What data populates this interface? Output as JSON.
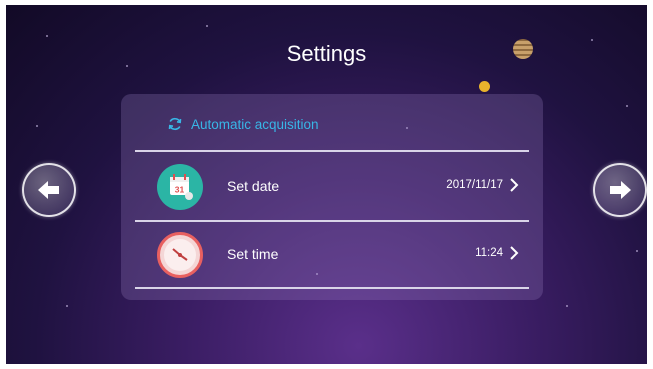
{
  "header": {
    "title": "Settings"
  },
  "auto_acquisition": {
    "label": "Automatic acquisition"
  },
  "settings": [
    {
      "label": "Set date",
      "value": "2017/11/17"
    },
    {
      "label": "Set time",
      "value": "11:24"
    }
  ],
  "calendar_icon": {
    "day": "31"
  },
  "colors": {
    "accent": "#38b6e6",
    "calendar": "#2bb5a5",
    "clock": "#e86060"
  }
}
